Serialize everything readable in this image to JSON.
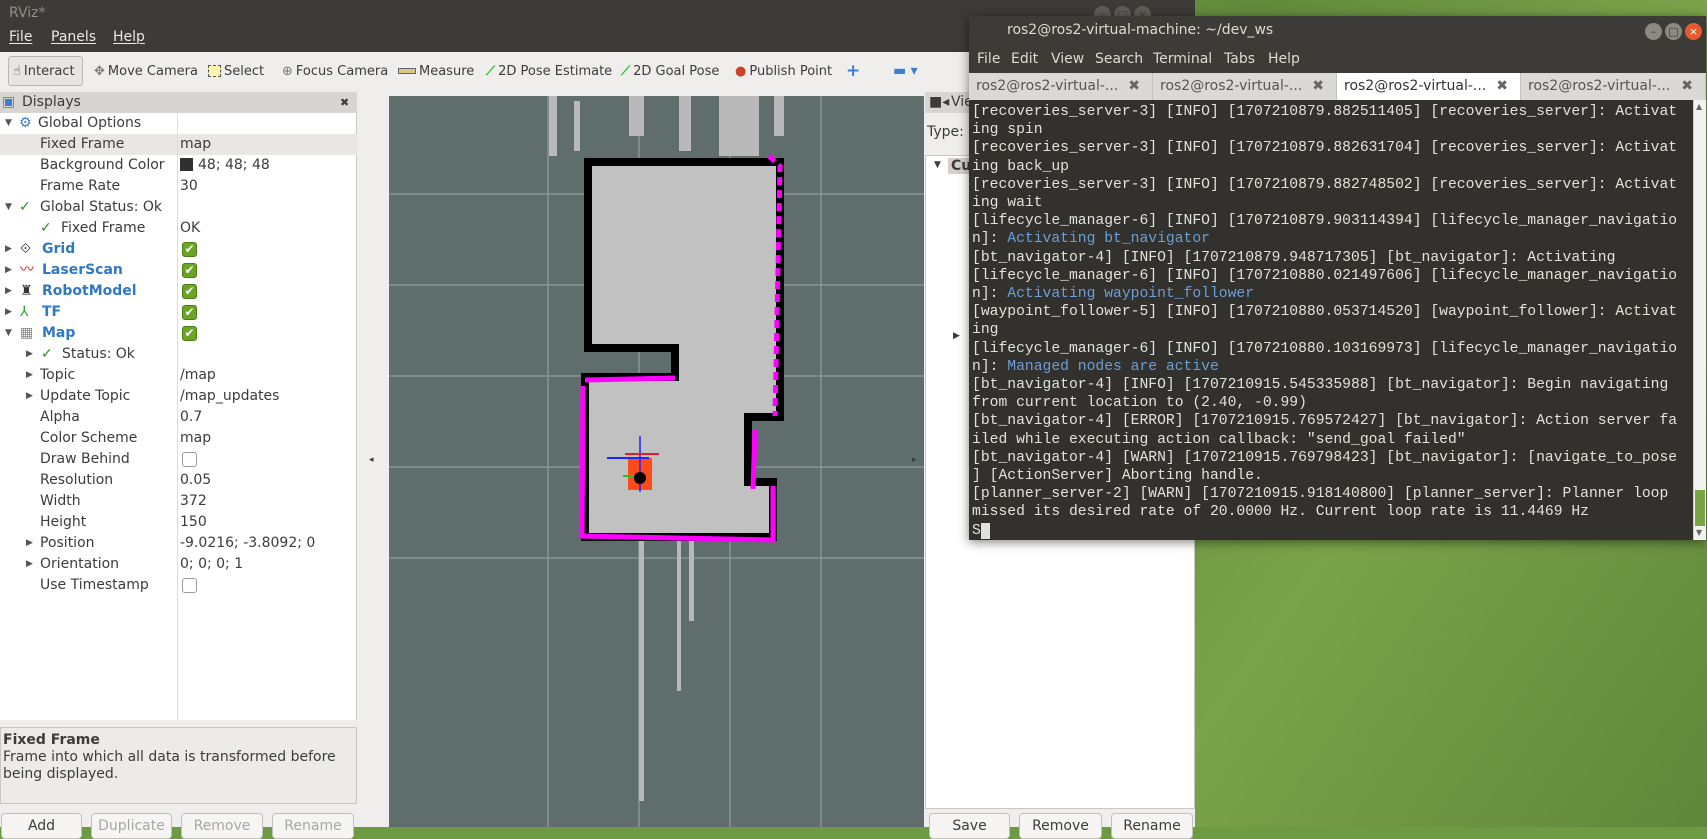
{
  "rviz": {
    "title": "RViz*",
    "menu": [
      "File",
      "Panels",
      "Help"
    ],
    "toolbar": [
      {
        "label": "Interact",
        "icon": "hand-icon"
      },
      {
        "label": "Move Camera",
        "icon": "move-icon"
      },
      {
        "label": "Select",
        "icon": "select-icon"
      },
      {
        "label": "Focus Camera",
        "icon": "focus-icon"
      },
      {
        "label": "Measure",
        "icon": "ruler-icon"
      },
      {
        "label": "2D Pose Estimate",
        "icon": "green-arrow-icon"
      },
      {
        "label": "2D Goal Pose",
        "icon": "green-arrow-icon"
      },
      {
        "label": "Publish Point",
        "icon": "map-pin-icon"
      }
    ],
    "displays": {
      "title": "Displays",
      "rows": [
        {
          "label": "Global Options",
          "value": ""
        },
        {
          "label": "Fixed Frame",
          "value": "map"
        },
        {
          "label": "Background Color",
          "value": "48; 48; 48"
        },
        {
          "label": "Frame Rate",
          "value": "30"
        },
        {
          "label": "Global Status: Ok",
          "value": ""
        },
        {
          "label": "Fixed Frame",
          "value": "OK"
        },
        {
          "label": "Grid",
          "checked": true
        },
        {
          "label": "LaserScan",
          "checked": true
        },
        {
          "label": "RobotModel",
          "checked": true
        },
        {
          "label": "TF",
          "checked": true
        },
        {
          "label": "Map",
          "checked": true
        },
        {
          "label": "Status: Ok",
          "value": ""
        },
        {
          "label": "Topic",
          "value": "/map"
        },
        {
          "label": "Update Topic",
          "value": "/map_updates"
        },
        {
          "label": "Alpha",
          "value": "0.7"
        },
        {
          "label": "Color Scheme",
          "value": "map"
        },
        {
          "label": "Draw Behind",
          "checked": false
        },
        {
          "label": "Resolution",
          "value": "0.05"
        },
        {
          "label": "Width",
          "value": "372"
        },
        {
          "label": "Height",
          "value": "150"
        },
        {
          "label": "Position",
          "value": "-9.0216; -3.8092; 0"
        },
        {
          "label": "Orientation",
          "value": "0; 0; 0; 1"
        },
        {
          "label": "Use Timestamp",
          "checked": false
        }
      ],
      "desc_title": "Fixed Frame",
      "desc_text": "Frame into which all data is transformed before being displayed.",
      "buttons": [
        "Add",
        "Duplicate",
        "Remove",
        "Rename"
      ]
    },
    "views": {
      "title": "Vie",
      "type_label": "Type:",
      "current": "Cu",
      "buttons": [
        "Save",
        "Remove",
        "Rename"
      ]
    },
    "background_color": "#303030",
    "accent": {
      "free": "#c1c1c1",
      "occupied": "#000000",
      "inflation": "#ff00ff",
      "robot": "#ff4a1a"
    }
  },
  "terminal": {
    "title": "ros2@ros2-virtual-machine: ~/dev_ws",
    "menu": [
      "File",
      "Edit",
      "View",
      "Search",
      "Terminal",
      "Tabs",
      "Help"
    ],
    "tabs": [
      "ros2@ros2-virtual-...",
      "ros2@ros2-virtual-...",
      "ros2@ros2-virtual-...",
      "ros2@ros2-virtual-..."
    ],
    "active_tab": 2,
    "lines": [
      [
        "[recoveries_server-3] [INFO] [1707210879.882511405] [recoveries_server]: Activat",
        ""
      ],
      [
        "ing spin",
        ""
      ],
      [
        "[recoveries_server-3] [INFO] [1707210879.882631704] [recoveries_server]: Activat",
        ""
      ],
      [
        "ing back_up",
        ""
      ],
      [
        "[recoveries_server-3] [INFO] [1707210879.882748502] [recoveries_server]: Activat",
        ""
      ],
      [
        "ing wait",
        ""
      ],
      [
        "[lifecycle_manager-6] [INFO] [1707210879.903114394] [lifecycle_manager_navigatio",
        ""
      ],
      [
        "n]: ",
        "Activating bt_navigator"
      ],
      [
        "[bt_navigator-4] [INFO] [1707210879.948717305] [bt_navigator]: Activating",
        ""
      ],
      [
        "[lifecycle_manager-6] [INFO] [1707210880.021497606] [lifecycle_manager_navigatio",
        ""
      ],
      [
        "n]: ",
        "Activating waypoint_follower"
      ],
      [
        "[waypoint_follower-5] [INFO] [1707210880.053714520] [waypoint_follower]: Activat",
        ""
      ],
      [
        "ing",
        ""
      ],
      [
        "[lifecycle_manager-6] [INFO] [1707210880.103169973] [lifecycle_manager_navigatio",
        ""
      ],
      [
        "n]: ",
        "Managed nodes are active"
      ],
      [
        "[bt_navigator-4] [INFO] [1707210915.545335988] [bt_navigator]: Begin navigating",
        ""
      ],
      [
        "from current location to (2.40, -0.99)",
        ""
      ],
      [
        "[bt_navigator-4] [ERROR] [1707210915.769572427] [bt_navigator]: Action server fa",
        ""
      ],
      [
        "iled while executing action callback: \"send_goal failed\"",
        ""
      ],
      [
        "[bt_navigator-4] [WARN] [1707210915.769798423] [bt_navigator]: [navigate_to_pose",
        ""
      ],
      [
        "] [ActionServer] Aborting handle.",
        ""
      ],
      [
        "[planner_server-2] [WARN] [1707210915.918140800] [planner_server]: Planner loop",
        ""
      ],
      [
        "missed its desired rate of 20.0000 Hz. Current loop rate is 11.4469 Hz",
        ""
      ]
    ],
    "prompt": "S"
  }
}
